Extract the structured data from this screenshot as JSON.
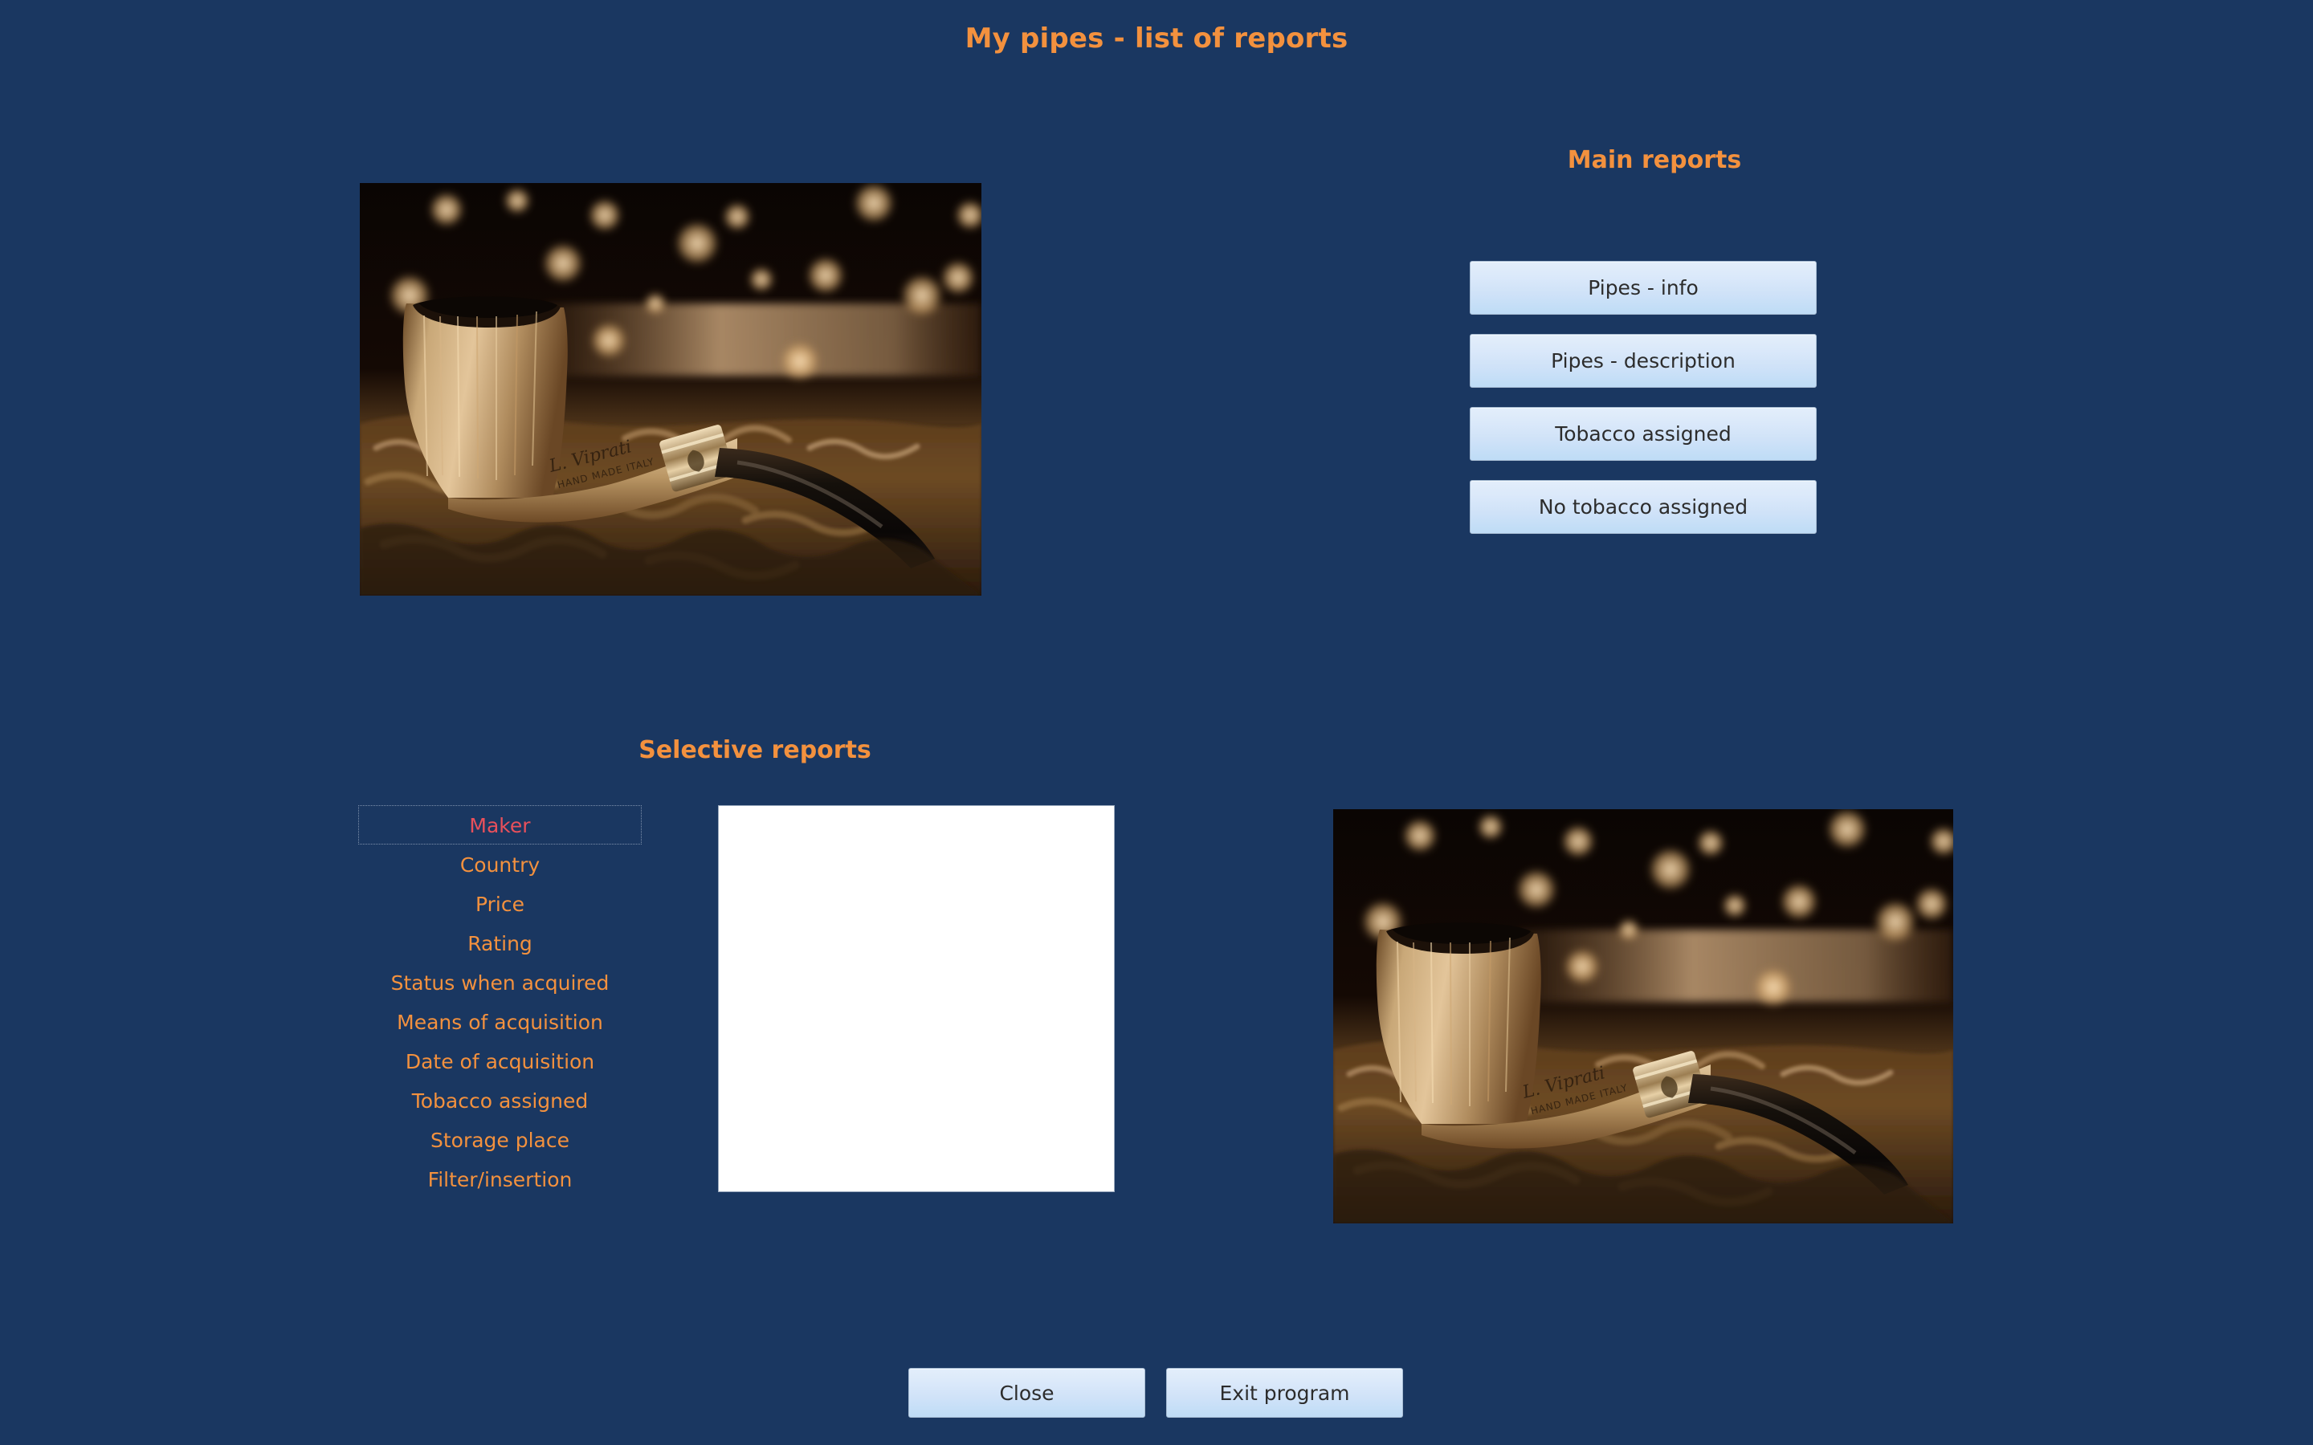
{
  "window": {
    "title": "My pipes - list of reports",
    "background_color": "#1a3761",
    "accent_color": "#f3913e",
    "selection_color": "#e8505b"
  },
  "main_reports": {
    "heading": "Main reports",
    "buttons": [
      {
        "label": "Pipes - info"
      },
      {
        "label": "Pipes - description"
      },
      {
        "label": "Tobacco assigned"
      },
      {
        "label": "No tobacco assigned"
      }
    ]
  },
  "selective_reports": {
    "heading": "Selective reports",
    "items": [
      {
        "label": "Maker",
        "selected": true
      },
      {
        "label": "Country",
        "selected": false
      },
      {
        "label": "Price",
        "selected": false
      },
      {
        "label": "Rating",
        "selected": false
      },
      {
        "label": "Status when acquired",
        "selected": false
      },
      {
        "label": "Means of acquisition",
        "selected": false
      },
      {
        "label": "Date of acquisition",
        "selected": false
      },
      {
        "label": "Tobacco assigned",
        "selected": false
      },
      {
        "label": "Storage place",
        "selected": false
      },
      {
        "label": "Filter/insertion",
        "selected": false
      }
    ],
    "results_panel": {
      "content": ""
    }
  },
  "images": {
    "top": {
      "name": "pipe-photo",
      "description": "Sepia photo of a briar tobacco pipe resting on loose tobacco with bokeh lights"
    },
    "bottom": {
      "name": "pipe-photo",
      "description": "Sepia photo of a briar tobacco pipe resting on loose tobacco with bokeh lights"
    }
  },
  "footer": {
    "close_label": "Close",
    "exit_label": "Exit program"
  }
}
